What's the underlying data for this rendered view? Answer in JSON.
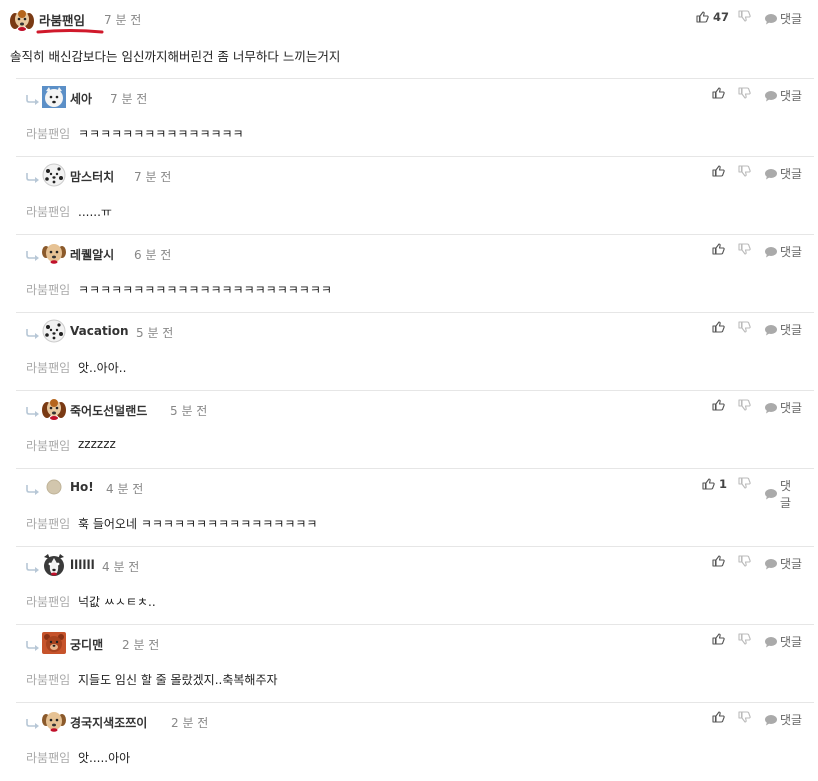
{
  "top_comment": {
    "author": "라붐팬임",
    "time": "7 분 전",
    "text": "솔직히 배신감보다는 임신까지해버린건 좀 너무하다 느끼는거지",
    "like_count": "47",
    "reply_label": "댓글"
  },
  "replies": [
    {
      "author": "세아",
      "time": "7 분 전",
      "mention": "라붐팬임",
      "text": "ㅋㅋㅋㅋㅋㅋㅋㅋㅋㅋㅋㅋㅋㅋㅋ",
      "like_count": "",
      "reply_label": "댓글"
    },
    {
      "author": "맘스터치",
      "time": "7 분 전",
      "mention": "라붐팬임",
      "text": "......ㅠ",
      "like_count": "",
      "reply_label": "댓글"
    },
    {
      "author": "레퀠알시",
      "time": "6 분 전",
      "mention": "라붐팬임",
      "text": "ㅋㅋㅋㅋㅋㅋㅋㅋㅋㅋㅋㅋㅋㅋㅋㅋㅋㅋㅋㅋㅋㅋㅋ",
      "like_count": "",
      "reply_label": "댓글"
    },
    {
      "author": "Vacation",
      "time": "5 분 전",
      "mention": "라붐팬임",
      "text": "앗..아아..",
      "like_count": "",
      "reply_label": "댓글"
    },
    {
      "author": "죽어도선덜랜드",
      "time": "5 분 전",
      "mention": "라붐팬임",
      "text": "zzzzzz",
      "like_count": "",
      "reply_label": "댓글"
    },
    {
      "author": "Ho!",
      "time": "4 분 전",
      "mention": "라붐팬임",
      "text": "훅 들어오네 ㅋㅋㅋㅋㅋㅋㅋㅋㅋㅋㅋㅋㅋㅋㅋㅋ",
      "like_count": "1",
      "reply_label": "댓글"
    },
    {
      "author": "llllll",
      "time": "4 분 전",
      "mention": "라붐팬임",
      "text": "넉값 ㅆㅅㅌㅊ..",
      "like_count": "",
      "reply_label": "댓글"
    },
    {
      "author": "궁디맨",
      "time": "2 분 전",
      "mention": "라붐팬임",
      "text": "지들도 임신 할 줄 몰랐겠지..축복해주자",
      "like_count": "",
      "reply_label": "댓글"
    },
    {
      "author": "경국지색조쯔이",
      "time": "2 분 전",
      "mention": "라붐팬임",
      "text": "앗.....아아",
      "like_count": "",
      "reply_label": "댓글"
    }
  ],
  "avatars": [
    "beagle-avatar-icon",
    "samoyed-avatar-icon",
    "dalmatian-avatar-icon",
    "puppy-avatar-icon",
    "dalmatian-avatar-icon",
    "beagle-avatar-icon",
    "gray-dot-avatar-icon",
    "husky-avatar-icon",
    "bear-avatar-icon",
    "puppy-avatar-icon"
  ],
  "colors": {
    "underline": "#d0192b",
    "muted": "#888888",
    "border": "#e6e6e6"
  }
}
